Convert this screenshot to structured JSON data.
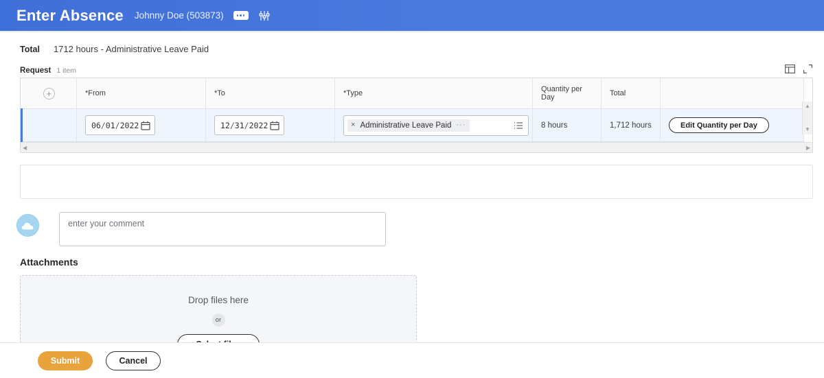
{
  "header": {
    "title": "Enter Absence",
    "subject": "Johnny Doe (503873)",
    "more_icon": "more-horizontal-icon",
    "settings_icon": "sliders-icon",
    "background_color": "#4a7ade"
  },
  "summary": {
    "label": "Total",
    "value": "1712 hours - Administrative Leave Paid"
  },
  "request_grid": {
    "caption": "Request",
    "item_count": "1 item",
    "tools": {
      "layout_icon": "table-layout-icon",
      "expand_icon": "expand-fullscreen-icon"
    },
    "columns": [
      {
        "label": "",
        "name": "add-row"
      },
      {
        "label": "*From",
        "name": "from"
      },
      {
        "label": "*To",
        "name": "to"
      },
      {
        "label": "*Type",
        "name": "type"
      },
      {
        "label": "Quantity per Day",
        "name": "quantity-per-day"
      },
      {
        "label": "Total",
        "name": "total"
      },
      {
        "label": "",
        "name": "actions"
      }
    ],
    "row": {
      "add_glyph": "+",
      "from_date": {
        "month": "06",
        "day": "01",
        "year": "2022"
      },
      "to_date": {
        "month": "12",
        "day": "31",
        "year": "2022"
      },
      "type": {
        "selected": "Administrative Leave Paid",
        "remove_glyph": "×",
        "overflow_glyph": "···",
        "prompt_icon": "list-menu-icon"
      },
      "quantity_per_day": "8 hours",
      "total": "1,712 hours",
      "action_button": "Edit Quantity per Day"
    },
    "scroll": {
      "up_glyph": "▲",
      "down_glyph": "▼",
      "left_glyph": "◀",
      "right_glyph": "▶"
    }
  },
  "comment": {
    "avatar_icon": "cloud-avatar-icon",
    "placeholder": "enter your comment",
    "value": ""
  },
  "attachments": {
    "title": "Attachments",
    "drop_text": "Drop files here",
    "or_text": "or",
    "select_button": "Select files"
  },
  "footer": {
    "submit_label": "Submit",
    "cancel_label": "Cancel",
    "submit_color": "#e8a33d"
  }
}
